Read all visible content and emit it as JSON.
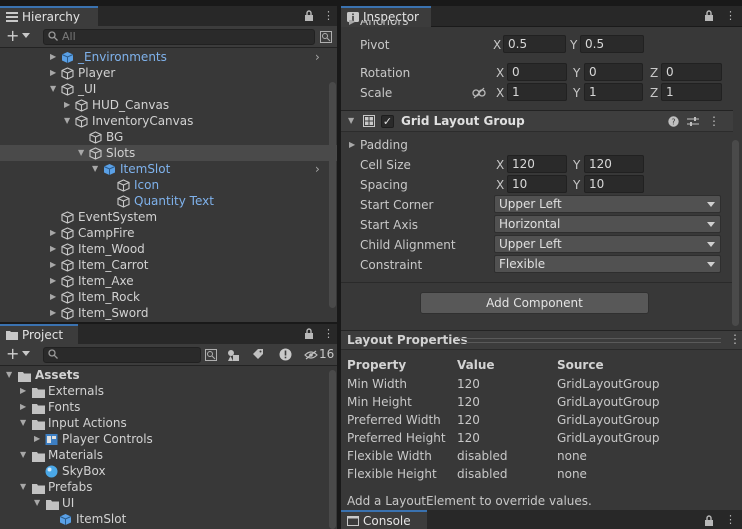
{
  "hierarchy": {
    "tab_label": "Hierarchy",
    "search_placeholder": "All",
    "rows": [
      {
        "label": "_Environments"
      },
      {
        "label": "Player"
      },
      {
        "label": "_UI"
      },
      {
        "label": "HUD_Canvas"
      },
      {
        "label": "InventoryCanvas"
      },
      {
        "label": "BG"
      },
      {
        "label": "Slots"
      },
      {
        "label": "ItemSlot"
      },
      {
        "label": "Icon"
      },
      {
        "label": "Quantity Text"
      },
      {
        "label": "EventSystem"
      },
      {
        "label": "CampFire"
      },
      {
        "label": "Item_Wood"
      },
      {
        "label": "Item_Carrot"
      },
      {
        "label": "Item_Axe"
      },
      {
        "label": "Item_Rock"
      },
      {
        "label": "Item_Sword"
      }
    ]
  },
  "project": {
    "tab_label": "Project",
    "hidden_count": "16",
    "rows": [
      {
        "label": "Assets"
      },
      {
        "label": "Externals"
      },
      {
        "label": "Fonts"
      },
      {
        "label": "Input Actions"
      },
      {
        "label": "Player Controls"
      },
      {
        "label": "Materials"
      },
      {
        "label": "SkyBox"
      },
      {
        "label": "Prefabs"
      },
      {
        "label": "UI"
      },
      {
        "label": "ItemSlot"
      }
    ]
  },
  "inspector": {
    "tab_label": "Inspector",
    "anchors_label": "Anchors",
    "pivot": {
      "label": "Pivot",
      "x": "0.5",
      "y": "0.5"
    },
    "rotation": {
      "label": "Rotation",
      "x": "0",
      "y": "0",
      "z": "0"
    },
    "scale": {
      "label": "Scale",
      "x": "1",
      "y": "1",
      "z": "1"
    },
    "axis_x": "X",
    "axis_y": "Y",
    "axis_z": "Z",
    "grid": {
      "title": "Grid Layout Group",
      "padding_label": "Padding",
      "cell_size": {
        "label": "Cell Size",
        "x": "120",
        "y": "120"
      },
      "spacing": {
        "label": "Spacing",
        "x": "10",
        "y": "10"
      },
      "start_corner": {
        "label": "Start Corner",
        "value": "Upper Left"
      },
      "start_axis": {
        "label": "Start Axis",
        "value": "Horizontal"
      },
      "child_alignment": {
        "label": "Child Alignment",
        "value": "Upper Left"
      },
      "constraint": {
        "label": "Constraint",
        "value": "Flexible"
      }
    },
    "add_component": "Add Component"
  },
  "layout_properties": {
    "title": "Layout Properties",
    "headers": {
      "property": "Property",
      "value": "Value",
      "source": "Source"
    },
    "rows": [
      {
        "property": "Min Width",
        "value": "120",
        "source": "GridLayoutGroup"
      },
      {
        "property": "Min Height",
        "value": "120",
        "source": "GridLayoutGroup"
      },
      {
        "property": "Preferred Width",
        "value": "120",
        "source": "GridLayoutGroup"
      },
      {
        "property": "Preferred Height",
        "value": "120",
        "source": "GridLayoutGroup"
      },
      {
        "property": "Flexible Width",
        "value": "disabled",
        "source": "none"
      },
      {
        "property": "Flexible Height",
        "value": "disabled",
        "source": "none"
      }
    ],
    "footer": "Add a LayoutElement to override values."
  },
  "console": {
    "tab_label": "Console"
  },
  "colors": {
    "accent_blue": "#7fb2ec",
    "tab_highlight": "#3a72b0",
    "panel_bg": "#383838"
  }
}
